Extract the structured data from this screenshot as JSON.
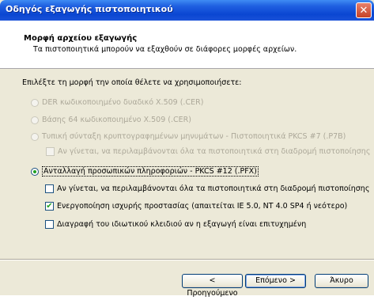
{
  "window": {
    "title": "Οδηγός εξαγωγής πιστοποιητικού",
    "close_glyph": "✕"
  },
  "header": {
    "title": "Μορφή αρχείου εξαγωγής",
    "subtitle": "Τα πιστοποιητικά μπορούν να εξαχθούν σε διάφορες μορφές αρχείων."
  },
  "prompt": "Επιλέξτε τη μορφή την οποία θέλετε να χρησιμοποιήσετε:",
  "options": {
    "der": {
      "label": "DER κωδικοποιημένο δυαδικό X.509 (.CER)",
      "enabled": false,
      "selected": false
    },
    "base64": {
      "label": "Βάσης 64 κωδικοποιημένο X.509 (.CER)",
      "enabled": false,
      "selected": false
    },
    "pkcs7": {
      "label": "Τυπική σύνταξη κρυπτογραφημένων μηνυμάτων - Πιστοποιητικά PKCS #7 (.P7B)",
      "enabled": false,
      "selected": false
    },
    "pkcs7_include_all": {
      "label": "Αν γίνεται, να περιλαμβάνονται όλα τα πιστοποιητικά στη διαδρομή πιστοποίησης",
      "enabled": false,
      "checked": false
    },
    "pfx": {
      "label": "Ανταλλαγή προσωπικών πληροφοριών - PKCS #12 (.PFX)",
      "enabled": true,
      "selected": true
    },
    "pfx_include_all": {
      "label": "Αν γίνεται, να περιλαμβάνονται όλα τα πιστοποιητικά στη διαδρομή πιστοποίησης",
      "checked": false
    },
    "pfx_strong_protection": {
      "label": "Ενεργοποίηση ισχυρής προστασίας (απαιτείται IE 5.0, NT 4.0 SP4 ή νεότερο)",
      "checked": true
    },
    "pfx_delete_key": {
      "label": "Διαγραφή του ιδιωτικού κλειδιού αν η εξαγωγή είναι επιτυχημένη",
      "checked": false
    }
  },
  "buttons": {
    "back": "< Προηγούμενο",
    "next": "Επόμενο >",
    "cancel": "Άκυρο"
  },
  "colors": {
    "titlebar": "#0a46d2",
    "dialog_bg": "#ece9d8",
    "check_mark": "#21a121",
    "close": "#c64227"
  }
}
